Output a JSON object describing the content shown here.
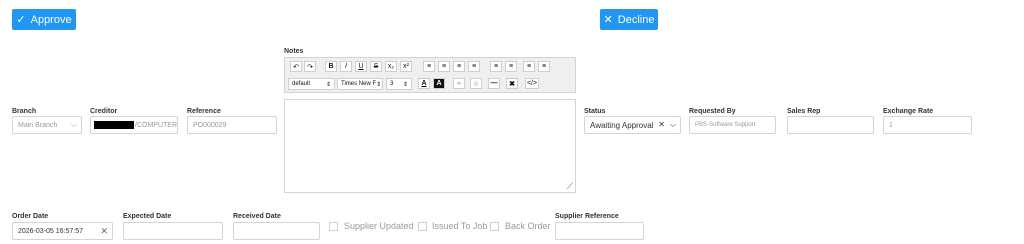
{
  "actions": {
    "approve_label": "Approve",
    "decline_label": "Decline"
  },
  "notes": {
    "label": "Notes",
    "toolbar_row1": [
      "↶",
      "↷",
      "B",
      "I",
      "U",
      "S",
      "x₂",
      "x²",
      "≡",
      "≡",
      "≡",
      "≡",
      "≡",
      "≡",
      "≡",
      "≡"
    ],
    "font_style": "default",
    "font_family": "Times New F",
    "font_size": "3",
    "color_a": "A",
    "bg_a": "A",
    "code": "</>"
  },
  "fields": {
    "branch": {
      "label": "Branch",
      "value": "Main Branch"
    },
    "creditor": {
      "label": "Creditor",
      "value": "/COMPUTER"
    },
    "reference": {
      "label": "Reference",
      "value": "PO000029"
    },
    "status": {
      "label": "Status",
      "value": "Awaiting Approval"
    },
    "requested_by": {
      "label": "Requested By",
      "value": "PBS-Software Support"
    },
    "sales_rep": {
      "label": "Sales Rep",
      "value": ""
    },
    "exchange_rate": {
      "label": "Exchange Rate",
      "value": "1"
    },
    "order_date": {
      "label": "Order Date",
      "value": "2026-03-05 16:57:57"
    },
    "expected_date": {
      "label": "Expected Date",
      "value": ""
    },
    "received_date": {
      "label": "Received Date",
      "value": ""
    },
    "supplier_reference": {
      "label": "Supplier Reference",
      "value": ""
    }
  },
  "checkboxes": {
    "supplier_updated": "Supplier Updated",
    "issued_to_job": "Issued To Job",
    "back_order": "Back Order"
  }
}
